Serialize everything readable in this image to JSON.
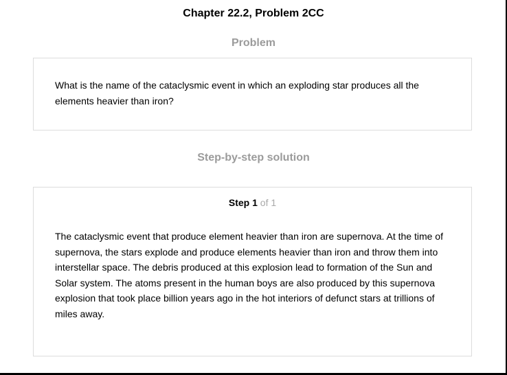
{
  "document": {
    "title": "Chapter 22.2, Problem 2CC"
  },
  "problem": {
    "heading": "Problem",
    "text": "What is the name of the cataclysmic event in which an exploding star produces all the elements heavier than iron?"
  },
  "solution": {
    "heading": "Step-by-step solution",
    "step": {
      "word": "Step",
      "number": "1",
      "of_text": "of 1"
    },
    "text": "The cataclysmic event that produce element heavier than iron are supernova. At the time of supernova, the stars explode and produce elements heavier than iron and throw them into interstellar space. The debris produced at this explosion lead to formation of the Sun and Solar system. The atoms present in the human boys are also produced by this supernova explosion that took place billion years ago in the hot interiors of defunct stars at trillions of miles away."
  }
}
